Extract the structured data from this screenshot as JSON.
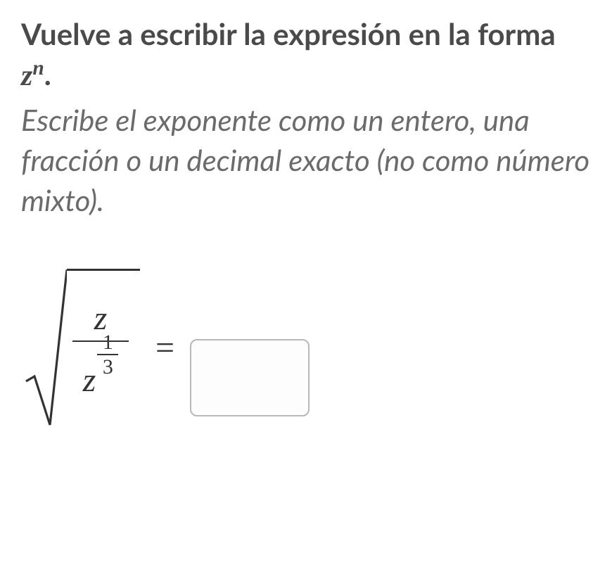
{
  "prompt": {
    "bold_text": "Vuelve a escribir la expresión en la forma ",
    "math_base": "z",
    "math_exp": "n",
    "period": ".",
    "italic_text": "Escribe el exponente como un entero, una fracción o un decimal exacto (no como número mixto)."
  },
  "equation": {
    "numerator": "z",
    "denom_base": "z",
    "denom_exp_num": "1",
    "denom_exp_den": "3",
    "equals": "="
  },
  "input": {
    "value": "",
    "placeholder": ""
  }
}
